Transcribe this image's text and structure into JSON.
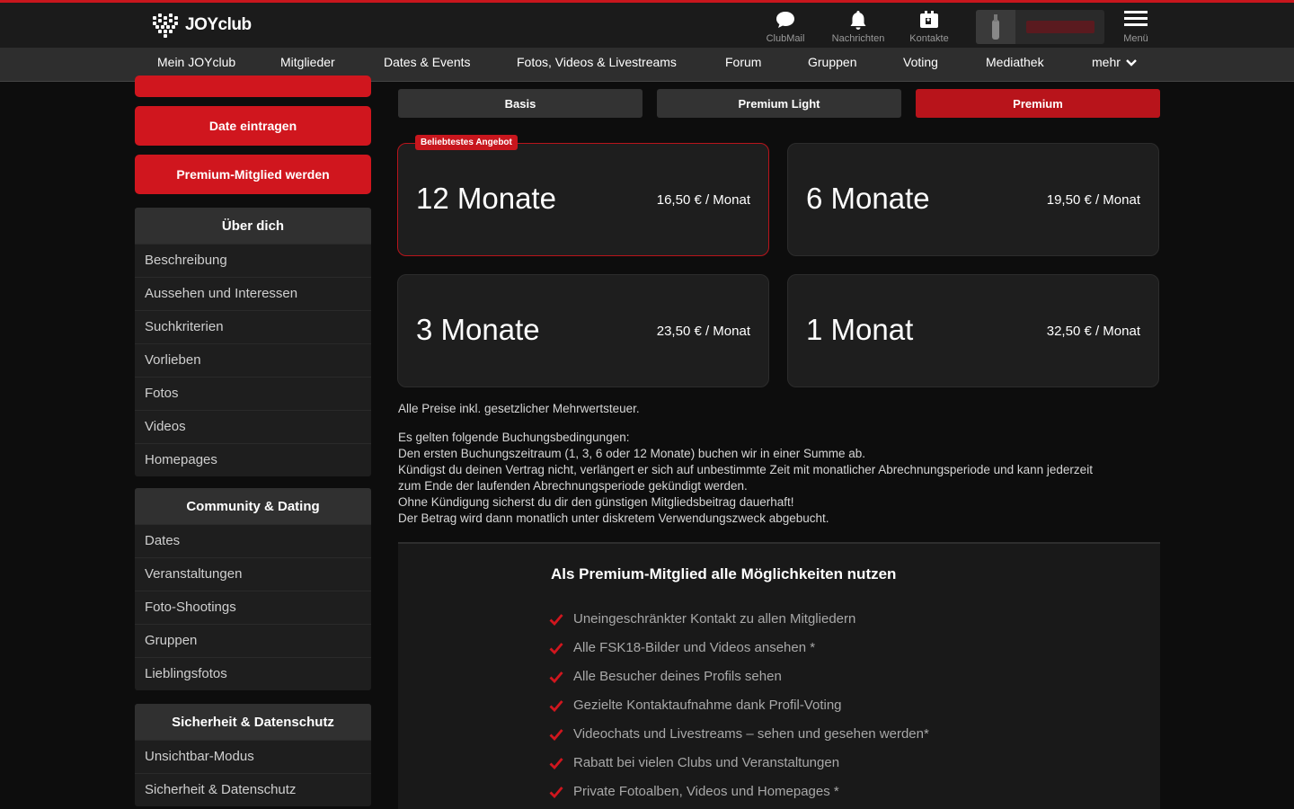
{
  "brand": {
    "name": "JOYclub",
    "accent": "#c8161d"
  },
  "topbar": {
    "icons": [
      {
        "label": "ClubMail",
        "icon": "chat-icon"
      },
      {
        "label": "Nachrichten",
        "icon": "bell-icon"
      },
      {
        "label": "Kontakte",
        "icon": "contacts-icon"
      },
      {
        "label": "Menü",
        "icon": "hamburger-icon"
      }
    ]
  },
  "nav": {
    "items": [
      "Mein JOYclub",
      "Mitglieder",
      "Dates & Events",
      "Fotos, Videos & Livestreams",
      "Forum",
      "Gruppen",
      "Voting",
      "Mediathek",
      "mehr"
    ]
  },
  "sidebar": {
    "buttons": [
      "Date eintragen",
      "Premium-Mitglied werden"
    ],
    "sections": [
      {
        "title": "Über dich",
        "items": [
          "Beschreibung",
          "Aussehen und Interessen",
          "Suchkriterien",
          "Vorlieben",
          "Fotos",
          "Videos",
          "Homepages"
        ]
      },
      {
        "title": "Community & Dating",
        "items": [
          "Dates",
          "Veranstaltungen",
          "Foto-Shootings",
          "Gruppen",
          "Lieblingsfotos"
        ]
      },
      {
        "title": "Sicherheit & Datenschutz",
        "items": [
          "Unsichtbar-Modus",
          "Sicherheit & Datenschutz"
        ]
      }
    ]
  },
  "tabs": {
    "items": [
      "Basis",
      "Premium Light",
      "Premium"
    ],
    "active": "Premium"
  },
  "plans": {
    "badge": "Beliebtestes Angebot",
    "items": [
      {
        "title": "12 Monate",
        "price": "16,50 € / Monat"
      },
      {
        "title": "6 Monate",
        "price": "19,50 € / Monat"
      },
      {
        "title": "3 Monate",
        "price": "23,50 € / Monat"
      },
      {
        "title": "1 Monat",
        "price": "32,50 € / Monat"
      }
    ]
  },
  "info": {
    "tax_note": "Alle Preise inkl. gesetzlicher Mehrwertsteuer.",
    "conditions": [
      "Es gelten folgende Buchungsbedingungen:",
      "Den ersten Buchungszeitraum (1, 3, 6 oder 12 Monate) buchen wir in einer Summe ab.",
      "Kündigst du deinen Vertrag nicht, verlängert er sich auf unbestimmte Zeit mit monatlicher Abrechnungsperiode und kann jederzeit",
      "zum Ende der laufenden Abrechnungsperiode gekündigt werden.",
      "Ohne Kündigung sicherst du dir den günstigen Mitgliedsbeitrag dauerhaft!",
      "Der Betrag wird dann monatlich unter diskretem Verwendungszweck abgebucht."
    ]
  },
  "benefits": {
    "title": "Als Premium-Mitglied alle Möglichkeiten nutzen",
    "items": [
      "Uneingeschränkter Kontakt zu allen Mitgliedern",
      "Alle FSK18-Bilder und Videos ansehen *",
      "Alle Besucher deines Profils sehen",
      "Gezielte Kontaktaufnahme dank Profil-Voting",
      "Videochats und Livestreams – sehen und gesehen werden*",
      "Rabatt bei vielen Clubs und Veranstaltungen",
      "Private Fotoalben, Videos und Homepages *"
    ]
  }
}
